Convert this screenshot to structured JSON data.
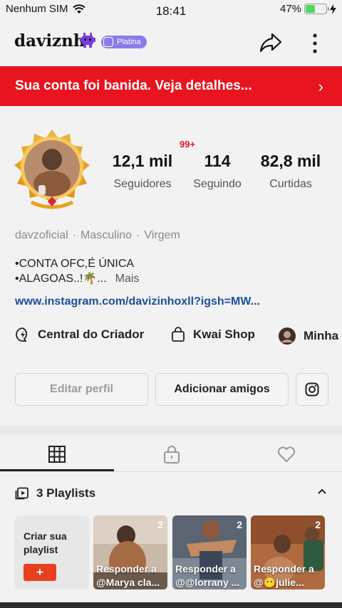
{
  "status_bar": {
    "carrier": "Nenhum SIM",
    "time": "18:41",
    "battery": "47%",
    "battery_fraction": 0.47,
    "battery_color": "#4cd964"
  },
  "header": {
    "username": "daviznh",
    "badge_label": "Platina",
    "icons": [
      "alien-emoji-icon",
      "platinum-badge-icon",
      "share-icon",
      "more-vertical-icon"
    ]
  },
  "banner": {
    "text": "Sua conta foi banida. Veja detalhes...",
    "chevron": "›",
    "color": "#e8141f"
  },
  "profile": {
    "notification_badge": "99+",
    "stats": [
      {
        "value": "12,1 mil",
        "label": "Seguidores"
      },
      {
        "value": "114",
        "label": "Seguindo"
      },
      {
        "value": "82,8 mil",
        "label": "Curtidas"
      }
    ],
    "meta": [
      "davzoficial",
      "Masculino",
      "Virgem"
    ],
    "meta_separator": "·",
    "bio_line1": "•CONTA OFC,É ÚNICA",
    "bio_line2": "•ALAGOAS..!🌴...",
    "bio_more": "Mais",
    "link": "www.instagram.com/davizinhoxll?igsh=MW..."
  },
  "quick_links": [
    {
      "label": "Central do Criador",
      "icon": "creator-center-icon"
    },
    {
      "label": "Kwai Shop",
      "icon": "shopping-bag-icon"
    },
    {
      "label": "Minha",
      "icon": "avatar-icon"
    }
  ],
  "actions": {
    "edit_profile": "Editar perfil",
    "add_friends": "Adicionar amigos",
    "instagram_icon": "instagram-icon"
  },
  "tabs": [
    {
      "name": "grid",
      "icon": "grid-icon",
      "active": true
    },
    {
      "name": "private",
      "icon": "lock-icon",
      "active": false
    },
    {
      "name": "liked",
      "icon": "heart-icon",
      "active": false
    }
  ],
  "playlists": {
    "header": "3 Playlists",
    "create_label": "Criar sua playlist",
    "create_button": "+",
    "items": [
      {
        "count": "2",
        "caption": "Responder a @Marya cla..."
      },
      {
        "count": "2",
        "caption": "Responder a @@lorrany ..."
      },
      {
        "count": "2",
        "caption": "Responder a @😶julie..."
      }
    ]
  }
}
